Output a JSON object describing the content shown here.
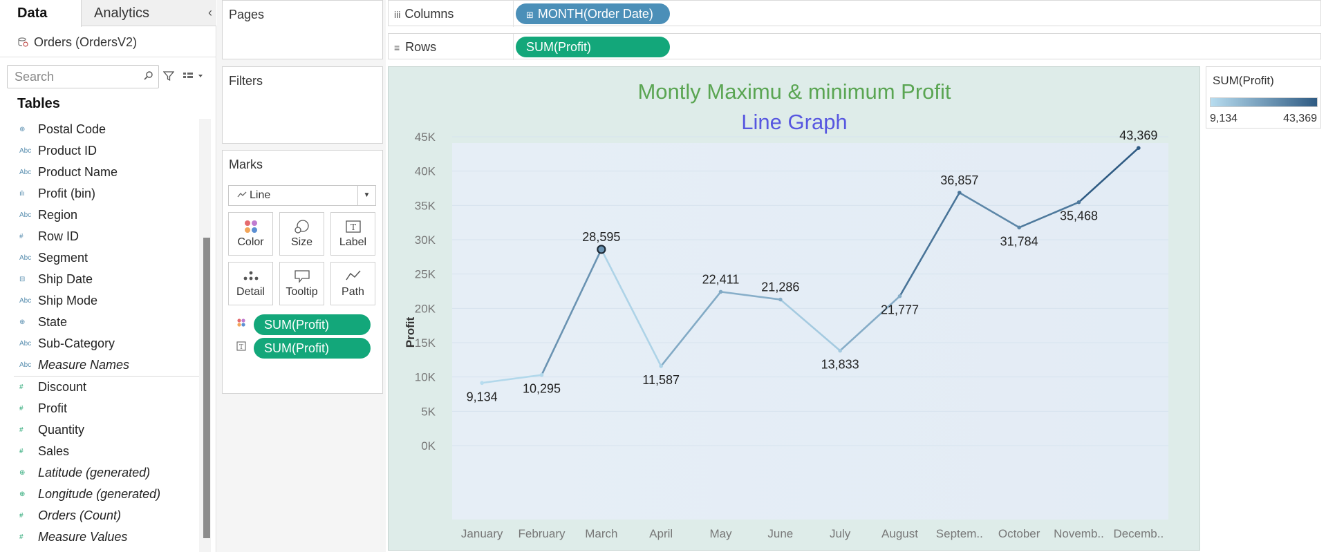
{
  "data_pane": {
    "tabs": [
      {
        "label": "Data"
      },
      {
        "label": "Analytics"
      }
    ],
    "collapse_glyph": "‹",
    "data_source": "Orders (OrdersV2)",
    "search": {
      "placeholder": "Search",
      "value": ""
    },
    "tables_heading": "Tables",
    "dimensions": [
      {
        "label": "Postal Code",
        "icon": "globe",
        "glyph": "⊕",
        "italic": false
      },
      {
        "label": "Product ID",
        "icon": "abc",
        "glyph": "Abc",
        "italic": false
      },
      {
        "label": "Product Name",
        "icon": "abc",
        "glyph": "Abc",
        "italic": false
      },
      {
        "label": "Profit (bin)",
        "icon": "bin",
        "glyph": "ılı",
        "italic": false
      },
      {
        "label": "Region",
        "icon": "abc",
        "glyph": "Abc",
        "italic": false
      },
      {
        "label": "Row ID",
        "icon": "number",
        "glyph": "#",
        "italic": false
      },
      {
        "label": "Segment",
        "icon": "abc",
        "glyph": "Abc",
        "italic": false
      },
      {
        "label": "Ship Date",
        "icon": "calendar",
        "glyph": "⊟",
        "italic": false
      },
      {
        "label": "Ship Mode",
        "icon": "abc",
        "glyph": "Abc",
        "italic": false
      },
      {
        "label": "State",
        "icon": "globe",
        "glyph": "⊕",
        "italic": false
      },
      {
        "label": "Sub-Category",
        "icon": "abc",
        "glyph": "Abc",
        "italic": false
      },
      {
        "label": "Measure Names",
        "icon": "abc",
        "glyph": "Abc",
        "italic": true
      }
    ],
    "measures": [
      {
        "label": "Discount",
        "icon": "number",
        "glyph": "#",
        "italic": false
      },
      {
        "label": "Profit",
        "icon": "number",
        "glyph": "#",
        "italic": false
      },
      {
        "label": "Quantity",
        "icon": "number",
        "glyph": "#",
        "italic": false
      },
      {
        "label": "Sales",
        "icon": "number",
        "glyph": "#",
        "italic": false
      },
      {
        "label": "Latitude (generated)",
        "icon": "globe",
        "glyph": "⊕",
        "italic": true
      },
      {
        "label": "Longitude (generated)",
        "icon": "globe",
        "glyph": "⊕",
        "italic": true
      },
      {
        "label": "Orders (Count)",
        "icon": "number",
        "glyph": "#",
        "italic": true
      },
      {
        "label": "Measure Values",
        "icon": "number",
        "glyph": "#",
        "italic": true
      }
    ]
  },
  "cards": {
    "pages_title": "Pages",
    "filters_title": "Filters",
    "marks_title": "Marks",
    "mark_type": "Line",
    "mark_buttons": {
      "color": "Color",
      "size": "Size",
      "label": "Label",
      "detail": "Detail",
      "tooltip": "Tooltip",
      "path": "Path"
    },
    "mark_pills": [
      {
        "label": "SUM(Profit)",
        "encoding": "color"
      },
      {
        "label": "SUM(Profit)",
        "encoding": "label"
      }
    ]
  },
  "shelves": {
    "columns_label": "Columns",
    "columns_pill": "MONTH(Order Date)",
    "rows_label": "Rows",
    "rows_pill": "SUM(Profit)"
  },
  "legend": {
    "title": "SUM(Profit)",
    "min": "9,134",
    "max": "43,369"
  },
  "colors": {
    "pill_green": "#13a77a",
    "pill_blue": "#4b8fb8",
    "title_green": "#5aa552",
    "subtitle_blue": "#5757e0",
    "line_light": "#b7dcef",
    "line_dark": "#2f5b83"
  },
  "chart_data": {
    "type": "line",
    "title": "Montly Maximu & minimum Profit",
    "subtitle": "Line Graph",
    "ylabel": "Profit",
    "xlabel": "",
    "categories": [
      "January",
      "February",
      "March",
      "April",
      "May",
      "June",
      "July",
      "August",
      "Septem..",
      "October",
      "Novemb..",
      "Decemb.."
    ],
    "values": [
      9134,
      10295,
      28595,
      11587,
      22411,
      21286,
      13833,
      21777,
      36857,
      31784,
      35468,
      43369
    ],
    "value_labels": [
      "9,134",
      "10,295",
      "28,595",
      "11,587",
      "22,411",
      "21,286",
      "13,833",
      "21,777",
      "36,857",
      "31,784",
      "35,468",
      "43,369"
    ],
    "label_positions": [
      "below",
      "below",
      "above",
      "below",
      "above",
      "above",
      "below",
      "below",
      "above",
      "below",
      "below",
      "above"
    ],
    "yticks": [
      0,
      5000,
      10000,
      15000,
      20000,
      25000,
      30000,
      35000,
      40000,
      45000
    ],
    "ytick_labels": [
      "0K",
      "5K",
      "10K",
      "15K",
      "20K",
      "25K",
      "30K",
      "35K",
      "40K",
      "45K"
    ],
    "ylim": [
      0,
      45000
    ],
    "highlighted_category": "March",
    "grid": true
  }
}
